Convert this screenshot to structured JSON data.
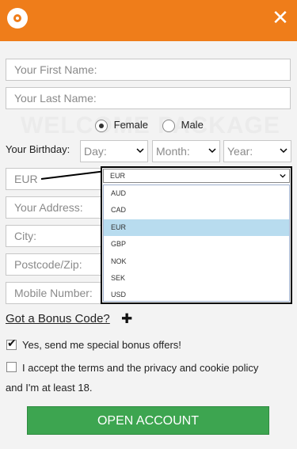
{
  "header": {
    "logo": "logo-icon",
    "close_icon": "close-icon",
    "close_glyph": "✕"
  },
  "form": {
    "first_name_placeholder": "Your First Name:",
    "last_name_placeholder": "Your Last Name:",
    "watermark": "WELCOME PACKAGE",
    "gender": {
      "female": "Female",
      "male": "Male",
      "selected": "Female"
    },
    "birthday_label": "Your Birthday:",
    "day": "Day:",
    "month": "Month:",
    "year": "Year:",
    "currency_value": "EUR",
    "address_placeholder": "Your Address:",
    "city_placeholder": "City:",
    "postcode_placeholder": "Postcode/Zip:",
    "mobile_placeholder": "Mobile Number:"
  },
  "currency_dropdown": {
    "selected": "EUR",
    "options": [
      "AUD",
      "CAD",
      "EUR",
      "GBP",
      "NOK",
      "SEK",
      "USD"
    ],
    "highlighted": "EUR"
  },
  "bonus": {
    "label": "Got a Bonus Code?",
    "plus": "✚"
  },
  "checkboxes": {
    "offers": "Yes, send me special bonus offers!",
    "terms_line1": "I accept the terms and the privacy and cookie policy",
    "terms_line2": "and I'm at least 18."
  },
  "cta": {
    "label": "OPEN ACCOUNT"
  },
  "colors": {
    "topbar": "#ef7d1a",
    "button": "#3da550",
    "highlight": "#b8dcef"
  }
}
